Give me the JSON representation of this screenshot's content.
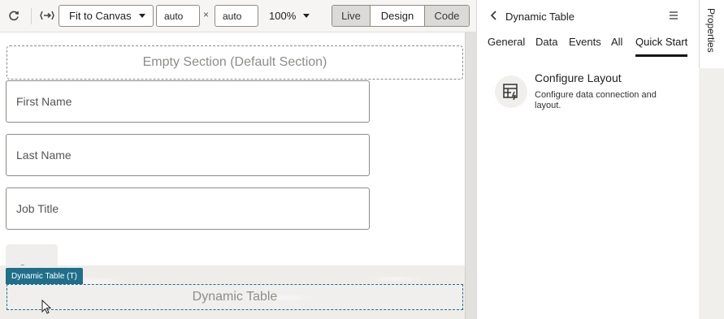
{
  "toolbar": {
    "refresh_icon": "refresh-icon",
    "fit_icon": "fit-icon",
    "fit_select": "Fit to Canvas",
    "width_value": "auto",
    "height_value": "auto",
    "times": "×",
    "zoom": "100%",
    "modes": [
      "Live",
      "Design",
      "Code"
    ],
    "selected_mode": "Design"
  },
  "canvas": {
    "empty_section": "Empty Section (Default Section)",
    "fields": [
      "First Name",
      "Last Name",
      "Job Title"
    ],
    "save_label": "Save",
    "dynamic_badge": "Dynamic Table (T)",
    "dynamic_placeholder": "Dynamic Table"
  },
  "panel": {
    "title": "Dynamic Table",
    "tabs": [
      "General",
      "Data",
      "Events",
      "All",
      "Quick Start"
    ],
    "active_tab": "Quick Start",
    "quick_start": {
      "title": "Configure Layout",
      "description": "Configure data connection and layout."
    }
  },
  "side_tab": "Properties",
  "colors": {
    "accent": "#1f6f8b",
    "canvas_bg": "#e8e6e3"
  }
}
